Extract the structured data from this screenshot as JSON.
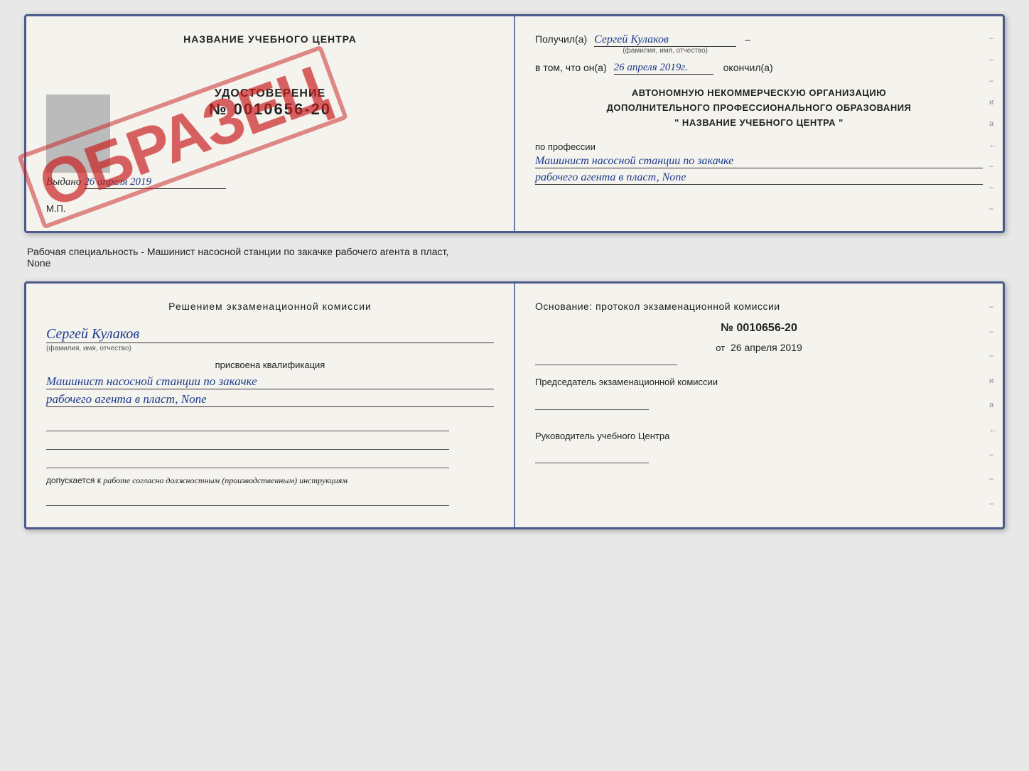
{
  "top_book": {
    "left": {
      "title": "НАЗВАНИЕ УЧЕБНОГО ЦЕНТРА",
      "cert_label": "УДОСТОВЕРЕНИЕ",
      "cert_number": "№ 0010656-20",
      "issued_label": "Выдано",
      "issued_date": "26 апреля 2019",
      "mp_label": "М.П.",
      "stamp": "ОБРАЗЕЦ"
    },
    "right": {
      "received_label": "Получил(а)",
      "received_name": "Сергей Кулаков",
      "name_sublabel": "(фамилия, имя, отчество)",
      "in_that_label": "в том, что он(а)",
      "date_value": "26 апреля 2019г.",
      "finished_label": "окончил(а)",
      "org_line1": "АВТОНОМНУЮ НЕКОММЕРЧЕСКУЮ ОРГАНИЗАЦИЮ",
      "org_line2": "ДОПОЛНИТЕЛЬНОГО ПРОФЕССИОНАЛЬНОГО ОБРАЗОВАНИЯ",
      "org_line3": "\" НАЗВАНИЕ УЧЕБНОГО ЦЕНТРА \"",
      "profession_label": "по профессии",
      "profession_line1": "Машинист насосной станции по закачке",
      "profession_line2": "рабочего агента в пласт, None",
      "margin_items": [
        "–",
        "–",
        "–",
        "и",
        "а",
        "←",
        "–",
        "–",
        "–"
      ]
    }
  },
  "separator": {
    "text": "Рабочая специальность - Машинист насосной станции по закачке рабочего агента в пласт,",
    "text2": "None"
  },
  "bottom_book": {
    "left": {
      "decision_title": "Решением экзаменационной комиссии",
      "person_name": "Сергей Кулаков",
      "name_sublabel": "(фамилия, имя, отчество)",
      "qualification_assigned": "присвоена квалификация",
      "qualification_line1": "Машинист насосной станции по закачке",
      "qualification_line2": "рабочего агента в пласт, None",
      "допускается_label": "допускается к",
      "допускается_value": "работе согласно должностным (производственным) инструкциям"
    },
    "right": {
      "basis_title": "Основание: протокол экзаменационной комиссии",
      "protocol_number": "№ 0010656-20",
      "from_label": "от",
      "from_date": "26 апреля 2019",
      "chairman_label": "Председатель экзаменационной комиссии",
      "director_label": "Руководитель учебного Центра",
      "margin_items": [
        "–",
        "–",
        "–",
        "и",
        "а",
        "←",
        "–",
        "–",
        "–"
      ]
    }
  }
}
